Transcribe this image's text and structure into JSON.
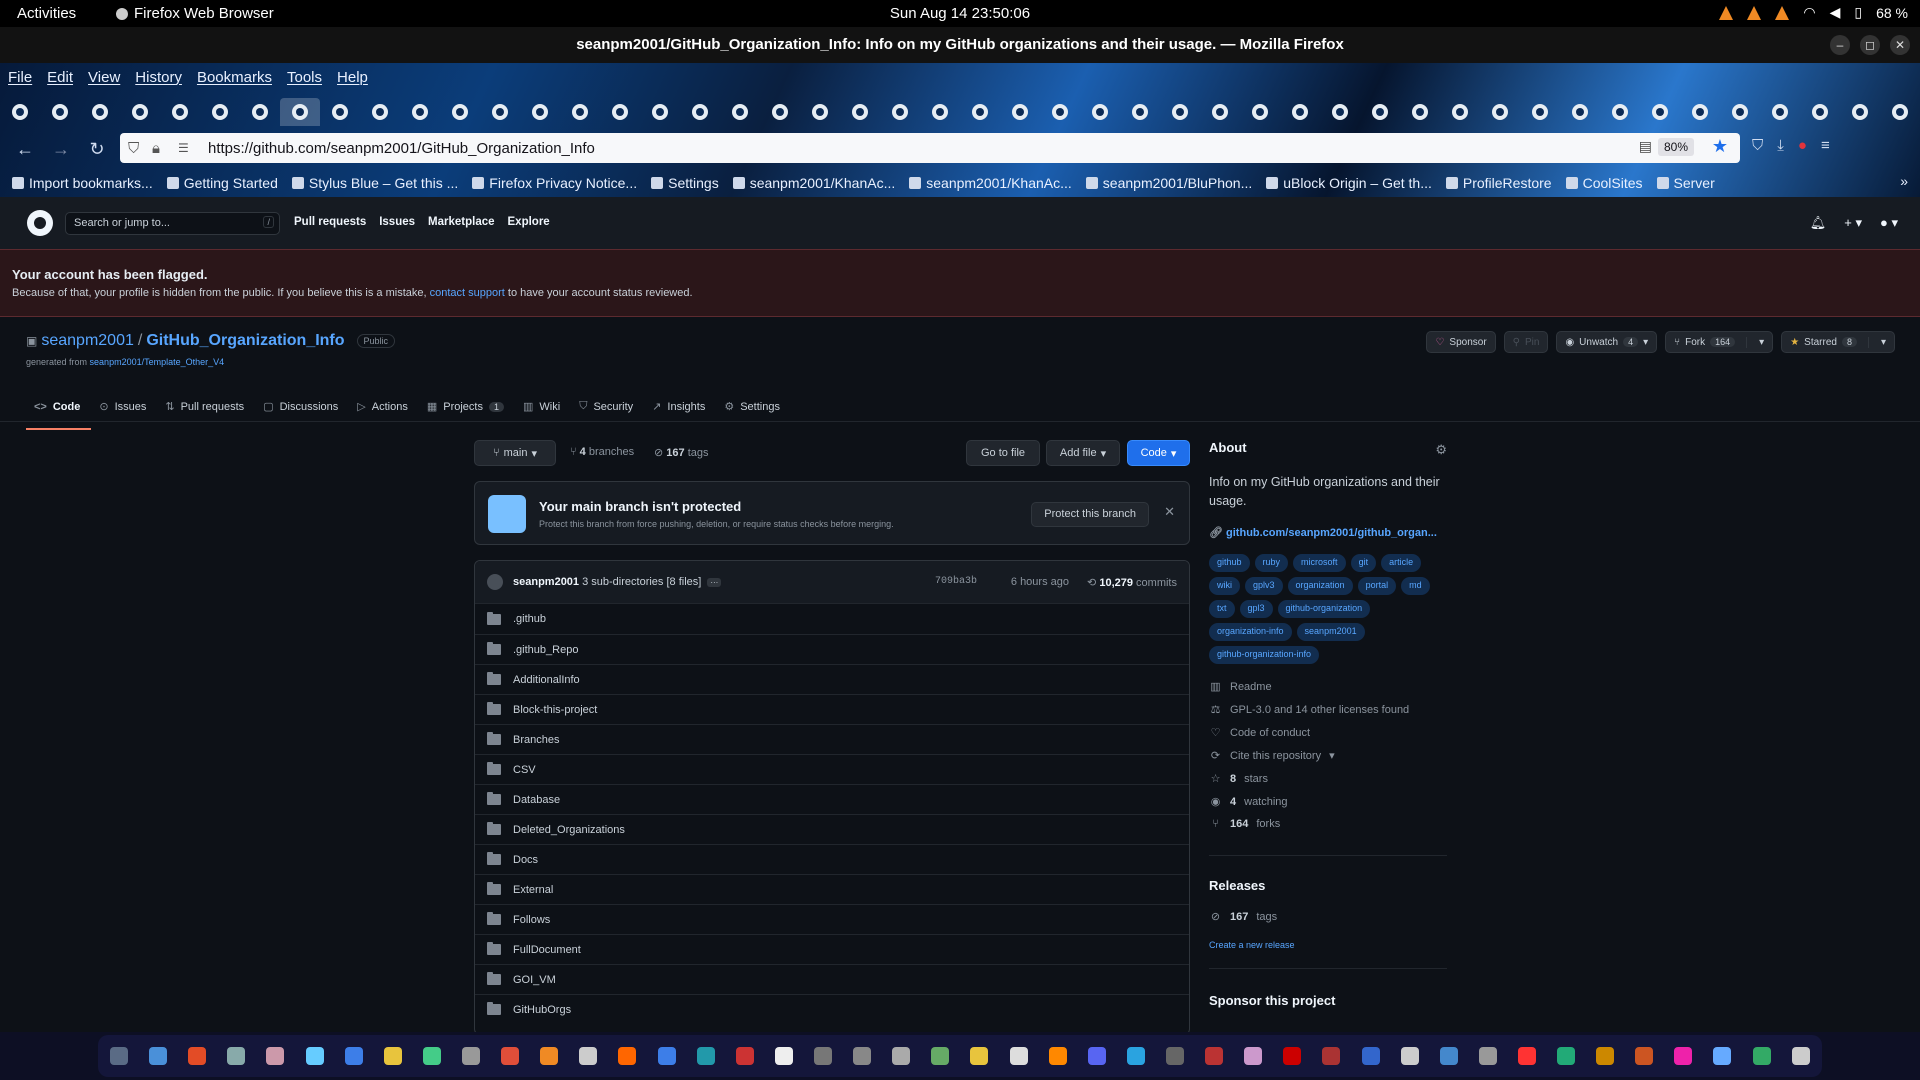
{
  "os": {
    "activities": "Activities",
    "app_name": "Firefox Web Browser",
    "clock": "Sun Aug 14  23:50:06",
    "battery": "68 %"
  },
  "window": {
    "title": "seanpm2001/GitHub_Organization_Info: Info on my GitHub organizations and their usage. — Mozilla Firefox"
  },
  "browser": {
    "menu": [
      "File",
      "Edit",
      "View",
      "History",
      "Bookmarks",
      "Tools",
      "Help"
    ],
    "url": "https://github.com/seanpm2001/GitHub_Organization_Info",
    "zoom": "80%",
    "bookmarks": [
      "Import bookmarks...",
      "Getting Started",
      "Stylus Blue – Get this ...",
      "Firefox Privacy Notice...",
      "Settings",
      "seanpm2001/KhanAc...",
      "seanpm2001/KhanAc...",
      "seanpm2001/BluPhon...",
      "uBlock Origin – Get th...",
      "ProfileRestore",
      "CoolSites",
      "Server"
    ]
  },
  "github": {
    "search_placeholder": "Search or jump to...",
    "search_key": "/",
    "nav": [
      "Pull requests",
      "Issues",
      "Marketplace",
      "Explore"
    ],
    "flag": {
      "heading": "Your account has been flagged.",
      "text_before": "Because of that, your profile is hidden from the public. If you believe this is a mistake, ",
      "link": "contact support",
      "text_after": " to have your account status reviewed."
    },
    "repo": {
      "owner": "seanpm2001",
      "separator": "/",
      "name": "GitHub_Organization_Info",
      "visibility": "Public",
      "generated_label": "generated from ",
      "generated_from": "seanpm2001/Template_Other_V4",
      "sponsor": "Sponsor",
      "pin": "Pin",
      "unwatch": "Unwatch",
      "watch_count": "4",
      "fork": "Fork",
      "fork_count": "164",
      "starred": "Starred",
      "star_count": "8"
    },
    "tabs": [
      {
        "label": "Code",
        "icon": "code-icon"
      },
      {
        "label": "Issues",
        "icon": "issue-icon"
      },
      {
        "label": "Pull requests",
        "icon": "pr-icon"
      },
      {
        "label": "Discussions",
        "icon": "discussion-icon"
      },
      {
        "label": "Actions",
        "icon": "play-icon"
      },
      {
        "label": "Projects",
        "icon": "table-icon",
        "count": "1"
      },
      {
        "label": "Wiki",
        "icon": "book-icon"
      },
      {
        "label": "Security",
        "icon": "shield-icon"
      },
      {
        "label": "Insights",
        "icon": "graph-icon"
      },
      {
        "label": "Settings",
        "icon": "gear-icon"
      }
    ],
    "branch": "main",
    "branches_count": "4",
    "branches_label": "branches",
    "tags_count": "167",
    "tags_label": "tags",
    "go_to_file": "Go to file",
    "add_file": "Add file",
    "code_btn": "Code",
    "protect": {
      "heading": "Your main branch isn't protected",
      "text": "Protect this branch from force pushing, deletion, or require status checks before merging.",
      "button": "Protect this branch"
    },
    "commit": {
      "author": "seanpm2001",
      "message": "3 sub-directories [8 files]",
      "sha": "709ba3b",
      "ago": "6 hours ago",
      "count": "10,279",
      "label": "commits"
    },
    "files": [
      ".github",
      ".github_Repo",
      "AdditionalInfo",
      "Block-this-project",
      "Branches",
      "CSV",
      "Database",
      "Deleted_Organizations",
      "Docs",
      "External",
      "Follows",
      "FullDocument",
      "GOI_VM",
      "GitHubOrgs"
    ],
    "about": {
      "heading": "About",
      "description": "Info on my GitHub organizations and their usage.",
      "link": "github.com/seanpm2001/github_organ...",
      "topics": [
        "github",
        "ruby",
        "microsoft",
        "git",
        "article",
        "wiki",
        "gplv3",
        "organization",
        "portal",
        "md",
        "txt",
        "gpl3",
        "github-organization",
        "organization-info",
        "seanpm2001",
        "github-organization-info"
      ],
      "readme": "Readme",
      "license": "GPL-3.0 and 14 other licenses found",
      "conduct": "Code of conduct",
      "cite": "Cite this repository",
      "stars_n": "8",
      "stars": "stars",
      "watching_n": "4",
      "watching": "watching",
      "forks_n": "164",
      "forks": "forks"
    },
    "releases": {
      "heading": "Releases",
      "tags_n": "167",
      "tags": "tags",
      "create": "Create a new release"
    },
    "sponsor_heading": "Sponsor this project"
  }
}
